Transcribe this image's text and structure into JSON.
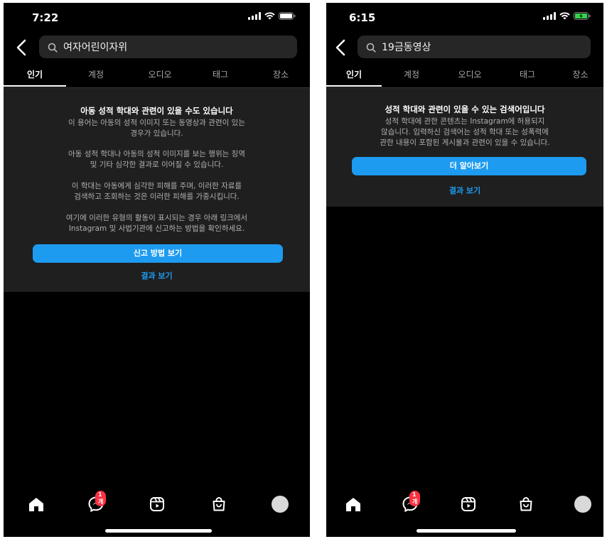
{
  "left": {
    "status": {
      "time": "7:22"
    },
    "search": {
      "value": "여자어린이자위"
    },
    "tabs": [
      {
        "label": "인기",
        "active": true
      },
      {
        "label": "계정",
        "active": false
      },
      {
        "label": "오디오",
        "active": false
      },
      {
        "label": "태그",
        "active": false
      },
      {
        "label": "장소",
        "active": false
      }
    ],
    "notice": {
      "title": "아동 성적 학대와 관련이 있을 수도 있습니다",
      "paragraphs": [
        "이 용어는 아동의 성적 이미지 또는 동영상과 관련이 있는\n경우가 있습니다.",
        "아동 성적 학대나 아동의 성적 이미지를 보는 행위는 징역\n및 기타 심각한 결과로 이어질 수 있습니다.",
        "이 학대는 아동에게 심각한 피해를 주며, 이러한 자료를\n검색하고 조회하는 것은 이러한 피해를 가중시킵니다.",
        "여기에 이러한 유형의 활동이 표시되는 경우 아래 링크에서\nInstagram 및 사법기관에 신고하는 방법을 확인하세요."
      ],
      "primary_button": "신고 방법 보기",
      "link_button": "결과 보기"
    },
    "nav": {
      "badge": "1개"
    }
  },
  "right": {
    "status": {
      "time": "6:15"
    },
    "search": {
      "value": "19금동영상"
    },
    "tabs": [
      {
        "label": "인기",
        "active": true
      },
      {
        "label": "계정",
        "active": false
      },
      {
        "label": "오디오",
        "active": false
      },
      {
        "label": "태그",
        "active": false
      },
      {
        "label": "장소",
        "active": false
      }
    ],
    "notice": {
      "title": "성적 학대와 관련이 있을 수 있는 검색어입니다",
      "paragraphs": [
        "성적 학대에 관한 콘텐츠는 Instagram에 허용되지\n않습니다. 입력하신 검색어는 성적 학대 또는 성폭력에\n관한 내용이 포함된 게시물과 관련이 있을 수 있습니다."
      ],
      "primary_button": "더 알아보기",
      "link_button": "결과 보기"
    },
    "nav": {
      "badge": "1개"
    }
  },
  "icons": [
    "back-icon",
    "search-icon",
    "home-icon",
    "messenger-icon",
    "reels-icon",
    "shop-icon",
    "avatar"
  ],
  "colors": {
    "background": "#000000",
    "notice_bg": "#1f1f1f",
    "accent": "#1d9bf0",
    "badge": "#ff3040"
  }
}
